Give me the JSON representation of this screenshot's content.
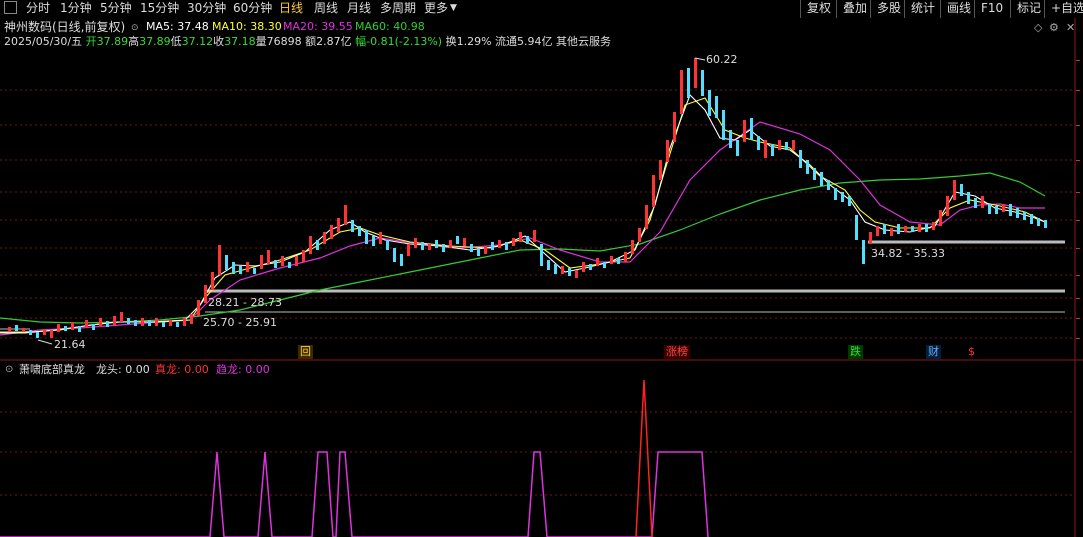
{
  "toolbar": {
    "timeframes": [
      "分时",
      "1分钟",
      "5分钟",
      "15分钟",
      "30分钟",
      "60分钟",
      "日线",
      "周线",
      "月线",
      "多周期",
      "更多"
    ],
    "active": "日线",
    "right_tools": [
      "复权",
      "叠加",
      "多股",
      "统计",
      "画线",
      "F10",
      "标记",
      "+自选"
    ]
  },
  "header": {
    "title": "神州数码(日线,前复权)",
    "ma5": "MA5: 37.48",
    "ma10": "MA10: 38.30",
    "ma20": "MA20: 39.55",
    "ma60": "MA60: 40.98"
  },
  "quote": {
    "date": "2025/05/30/五",
    "open_label": "开",
    "open": "37.89",
    "high_label": "高",
    "high": "37.89",
    "low_label": "低",
    "low": "37.12",
    "close_label": "收",
    "close": "37.18",
    "vol_label": "量",
    "vol": "76898",
    "amount": "额2.87亿",
    "change": "幅-0.81(-2.13%)",
    "turnover": "换1.29%",
    "float": "流通5.94亿",
    "cloud": "其他云服务"
  },
  "annotations": {
    "high_price": "60.22",
    "low_price": "21.64",
    "zone_upper": "34.82 - 35.33",
    "zone_mid": "28.21 - 28.73",
    "zone_low": "25.70 - 25.91"
  },
  "events": [
    {
      "text": "回",
      "color": "#ffcc33"
    },
    {
      "text": "涨榜",
      "color": "#ff4444"
    },
    {
      "text": "跌",
      "color": "#33dd33"
    },
    {
      "text": "财",
      "color": "#66aaff"
    },
    {
      "text": "$",
      "color": "#ff3333"
    }
  ],
  "indicator": {
    "name": "萧啸底部真龙",
    "dragon_head": "龙头: 0.00",
    "true_dragon": "真龙: 0.00",
    "trend_dragon": "趋龙: 0.00"
  },
  "colors": {
    "up": "#ff3333",
    "down": "#55ddff",
    "ma5": "#ffffff",
    "ma10": "#ffff00",
    "ma20": "#dd33dd",
    "ma60": "#33cc33",
    "line_gray": "#bbbbbb",
    "indicator_magenta": "#dd33dd",
    "indicator_red": "#ff2222"
  }
}
